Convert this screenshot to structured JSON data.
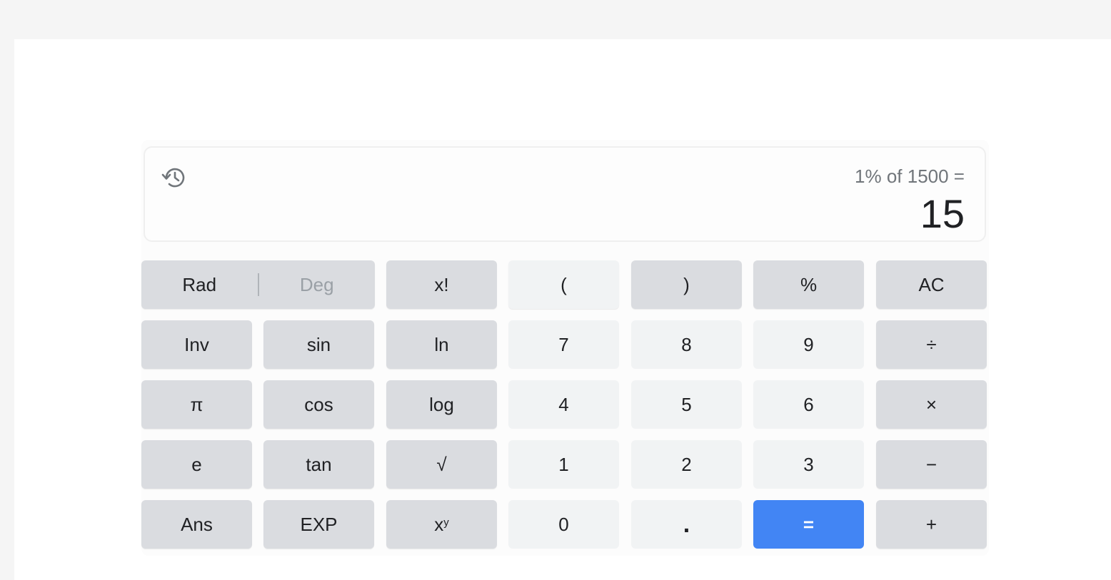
{
  "display": {
    "history_icon": "history-icon",
    "expression": "1% of 1500 =",
    "result": "15"
  },
  "keys": {
    "rad": "Rad",
    "deg": "Deg",
    "factorial": "x!",
    "open_paren": "(",
    "close_paren": ")",
    "percent": "%",
    "clear": "AC",
    "inv": "Inv",
    "sin": "sin",
    "ln": "ln",
    "seven": "7",
    "eight": "8",
    "nine": "9",
    "divide": "÷",
    "pi": "π",
    "cos": "cos",
    "log": "log",
    "four": "4",
    "five": "5",
    "six": "6",
    "multiply": "×",
    "e": "e",
    "tan": "tan",
    "sqrt": "√",
    "one": "1",
    "two": "2",
    "three": "3",
    "minus": "−",
    "ans": "Ans",
    "exp": "EXP",
    "power_base": "x",
    "power_exp": "y",
    "zero": "0",
    "decimal": ".",
    "equals": "=",
    "plus": "+"
  },
  "colors": {
    "function_key": "#dadce0",
    "number_key": "#f1f3f4",
    "equals_key": "#4285f4"
  }
}
